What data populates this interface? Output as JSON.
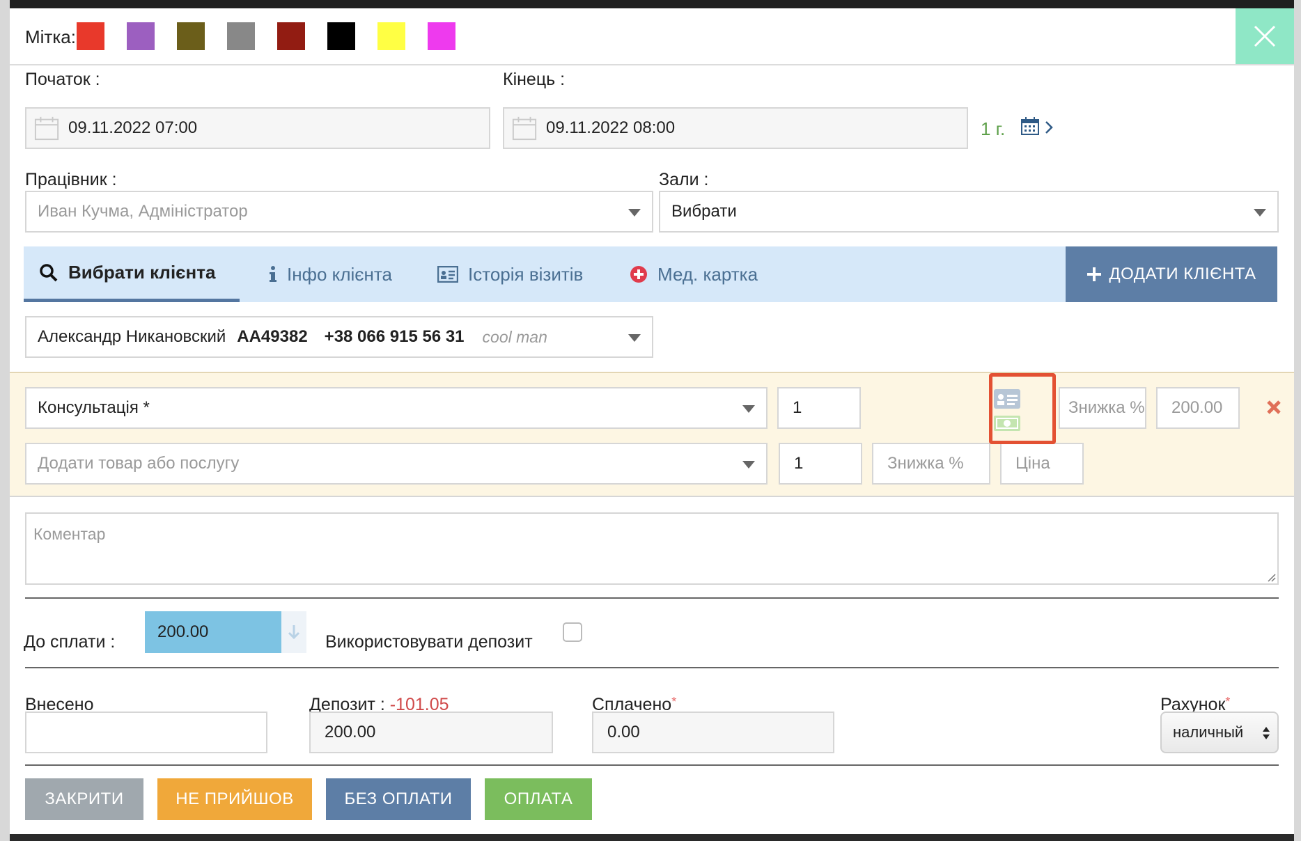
{
  "label": {
    "title": "Мітка:",
    "colors": [
      "#e8392b",
      "#9c5fc0",
      "#6b5e1a",
      "#888888",
      "#921c12",
      "#000000",
      "#ffff44",
      "#ee3aee"
    ]
  },
  "start": {
    "label": "Початок :",
    "value": "09.11.2022 07:00"
  },
  "end": {
    "label": "Кінець :",
    "value": "09.11.2022 08:00"
  },
  "duration": {
    "text": "1 г."
  },
  "employee": {
    "label": "Працівник :",
    "placeholder": "Иван Кучма, Адміністратор"
  },
  "halls": {
    "label": "Зали :",
    "value": "Вибрати"
  },
  "tabs": [
    {
      "label": "Вибрати клієнта",
      "icon": "search-icon"
    },
    {
      "label": "Інфо клієнта",
      "icon": "info-icon"
    },
    {
      "label": "Історія візитів",
      "icon": "id-card-icon"
    },
    {
      "label": "Мед. картка",
      "icon": "plus-circle-icon"
    }
  ],
  "add_client": {
    "label": "ДОДАТИ КЛІЄНТА"
  },
  "client": {
    "name": "Александр Никановский",
    "card": "AA49382",
    "phone": "+38 066 915 56 31",
    "note": "cool man"
  },
  "services": {
    "row1": {
      "name": "Консультація *",
      "qty": "1",
      "discount_placeholder": "Знижка %",
      "price": "200.00"
    },
    "row2": {
      "placeholder": "Додати товар або послугу",
      "qty": "1",
      "discount_placeholder": "Знижка %",
      "price_placeholder": "Ціна"
    }
  },
  "comment": {
    "placeholder": "Коментар"
  },
  "to_pay": {
    "label": "До сплати :",
    "value": "200.00"
  },
  "use_deposit": {
    "label": "Використовувати депозит"
  },
  "paid_in": {
    "label": "Внесено",
    "value": ""
  },
  "deposit": {
    "label": "Депозит :",
    "balance": "-101.05",
    "value": "200.00"
  },
  "paid": {
    "label": "Сплачено",
    "required": "*",
    "value": "0.00"
  },
  "account": {
    "label": "Рахунок",
    "required": "*",
    "value": "наличный"
  },
  "buttons": {
    "close": "ЗАКРИТИ",
    "no_show": "НЕ ПРИЙШОВ",
    "no_pay": "БЕЗ ОПЛАТИ",
    "pay": "ОПЛАТА"
  },
  "colors": {
    "accent": "#5d7ea6",
    "close_btn": "#a0a8ae",
    "no_show": "#f0a83a",
    "no_pay": "#5d7ea6",
    "pay": "#7bbd5d",
    "to_pay_bg": "#7dc3e3",
    "highlight": "#e35133"
  }
}
